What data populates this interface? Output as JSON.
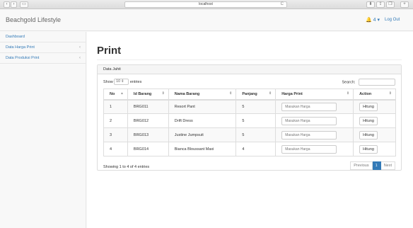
{
  "browser": {
    "url": "localhost",
    "reload_glyph": "C"
  },
  "app": {
    "brand": "Beachgold Lifestyle",
    "notif_count": "4",
    "logout": "Log Out"
  },
  "sidebar": {
    "items": [
      {
        "label": "Dashboard"
      },
      {
        "label": "Data Harga Print",
        "arrow": "‹"
      },
      {
        "label": "Data Produksi Print",
        "arrow": "‹"
      }
    ]
  },
  "page": {
    "title": "Print"
  },
  "panel": {
    "heading": "Data Jahit",
    "show_label": "Show",
    "entries_value": "10",
    "entries_label": "entries",
    "search_label": "Search:"
  },
  "table": {
    "headers": [
      "No",
      "Id Barang",
      "Nama Barang",
      "Panjang",
      "Harga Print",
      "Action"
    ],
    "input_placeholder": "Masukan Harga",
    "action_label": "Hitung",
    "rows": [
      {
        "no": "1",
        "id": "BRG011",
        "nama": "Resort Pant",
        "panjang": "5"
      },
      {
        "no": "2",
        "id": "BRG012",
        "nama": "Drift Dress",
        "panjang": "5"
      },
      {
        "no": "3",
        "id": "BRG013",
        "nama": "Justine Jumpsuit",
        "panjang": "5"
      },
      {
        "no": "4",
        "id": "BRG014",
        "nama": "Bianca Bloussant Maxi",
        "panjang": "4"
      }
    ]
  },
  "footer": {
    "info": "Showing 1 to 4 of 4 entries",
    "previous": "Previous",
    "page": "1",
    "next": "Next"
  }
}
